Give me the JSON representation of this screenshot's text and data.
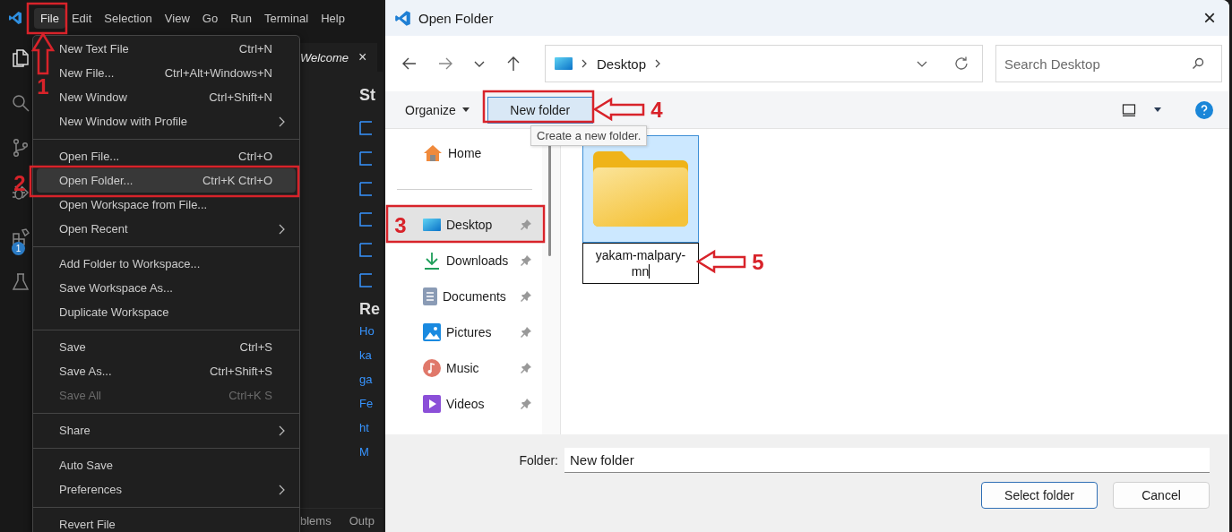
{
  "editor": {
    "menubar": [
      {
        "label": "File",
        "selected": true
      },
      {
        "label": "Edit",
        "selected": false
      },
      {
        "label": "Selection",
        "selected": false
      },
      {
        "label": "View",
        "selected": false
      },
      {
        "label": "Go",
        "selected": false
      },
      {
        "label": "Run",
        "selected": false
      },
      {
        "label": "Terminal",
        "selected": false
      },
      {
        "label": "Help",
        "selected": false
      }
    ],
    "activity_bar": [
      {
        "kind": "explorer",
        "selected": true
      },
      {
        "kind": "search",
        "selected": false
      },
      {
        "kind": "source-control",
        "selected": false
      },
      {
        "kind": "debug",
        "selected": false
      },
      {
        "kind": "extensions",
        "selected": false,
        "badge": "1"
      },
      {
        "kind": "testing",
        "selected": false
      }
    ],
    "tab": {
      "label": "Welcome",
      "close": "×"
    },
    "welcome": {
      "start_heading": "St",
      "recent_heading": "Re",
      "recent_links": [
        "Ho",
        "ka",
        "ga",
        "Fe",
        "ht",
        "M"
      ]
    },
    "panel_tabs": [
      "blems",
      "Outp"
    ],
    "file_menu": [
      [
        {
          "label": "New Text File",
          "shortcut": "Ctrl+N",
          "submenu": false,
          "disabled": false,
          "selected": false
        },
        {
          "label": "New File...",
          "shortcut": "Ctrl+Alt+Windows+N",
          "submenu": false,
          "disabled": false,
          "selected": false
        },
        {
          "label": "New Window",
          "shortcut": "Ctrl+Shift+N",
          "submenu": false,
          "disabled": false,
          "selected": false
        },
        {
          "label": "New Window with Profile",
          "submenu": true,
          "disabled": false,
          "selected": false
        }
      ],
      [
        {
          "label": "Open File...",
          "shortcut": "Ctrl+O",
          "submenu": false,
          "disabled": false,
          "selected": false
        },
        {
          "label": "Open Folder...",
          "shortcut": "Ctrl+K Ctrl+O",
          "submenu": false,
          "disabled": false,
          "selected": true
        },
        {
          "label": "Open Workspace from File...",
          "submenu": false,
          "disabled": false,
          "selected": false
        },
        {
          "label": "Open Recent",
          "submenu": true,
          "disabled": false,
          "selected": false
        }
      ],
      [
        {
          "label": "Add Folder to Workspace...",
          "submenu": false,
          "disabled": false,
          "selected": false
        },
        {
          "label": "Save Workspace As...",
          "submenu": false,
          "disabled": false,
          "selected": false
        },
        {
          "label": "Duplicate Workspace",
          "submenu": false,
          "disabled": false,
          "selected": false
        }
      ],
      [
        {
          "label": "Save",
          "shortcut": "Ctrl+S",
          "submenu": false,
          "disabled": false,
          "selected": false
        },
        {
          "label": "Save As...",
          "shortcut": "Ctrl+Shift+S",
          "submenu": false,
          "disabled": false,
          "selected": false
        },
        {
          "label": "Save All",
          "shortcut": "Ctrl+K S",
          "submenu": false,
          "disabled": true,
          "selected": false
        }
      ],
      [
        {
          "label": "Share",
          "submenu": true,
          "disabled": false,
          "selected": false
        }
      ],
      [
        {
          "label": "Auto Save",
          "submenu": false,
          "disabled": false,
          "selected": false
        },
        {
          "label": "Preferences",
          "submenu": true,
          "disabled": false,
          "selected": false
        }
      ],
      [
        {
          "label": "Revert File",
          "submenu": false,
          "disabled": false,
          "selected": false
        }
      ]
    ]
  },
  "dialog": {
    "title": "Open Folder",
    "close": "×",
    "address": [
      "Desktop"
    ],
    "search": {
      "placeholder": "Search Desktop"
    },
    "toolbar": {
      "organize": "Organize",
      "new_folder": "New folder",
      "tooltip": "Create a new folder."
    },
    "nav_pane": [
      {
        "kind": "home",
        "label": "Home",
        "pinned": false,
        "selected": false
      },
      {
        "kind": "desktop",
        "label": "Desktop",
        "pinned": true,
        "selected": true
      },
      {
        "kind": "downloads",
        "label": "Downloads",
        "pinned": true,
        "selected": false
      },
      {
        "kind": "documents",
        "label": "Documents",
        "pinned": true,
        "selected": false
      },
      {
        "kind": "pictures",
        "label": "Pictures",
        "pinned": true,
        "selected": false
      },
      {
        "kind": "music",
        "label": "Music",
        "pinned": true,
        "selected": false
      },
      {
        "kind": "videos",
        "label": "Videos",
        "pinned": true,
        "selected": false
      }
    ],
    "items": [
      {
        "kind": "folder",
        "name": "yakam-malpary-mn",
        "selected": true,
        "renaming": true
      }
    ],
    "folder_field": {
      "label": "Folder:",
      "value": "New folder"
    },
    "buttons": [
      {
        "label": "Select folder",
        "default": true
      },
      {
        "label": "Cancel",
        "default": false
      }
    ]
  },
  "callouts": [
    {
      "number": "1"
    },
    {
      "number": "2"
    },
    {
      "number": "3"
    },
    {
      "number": "4"
    },
    {
      "number": "5"
    }
  ]
}
